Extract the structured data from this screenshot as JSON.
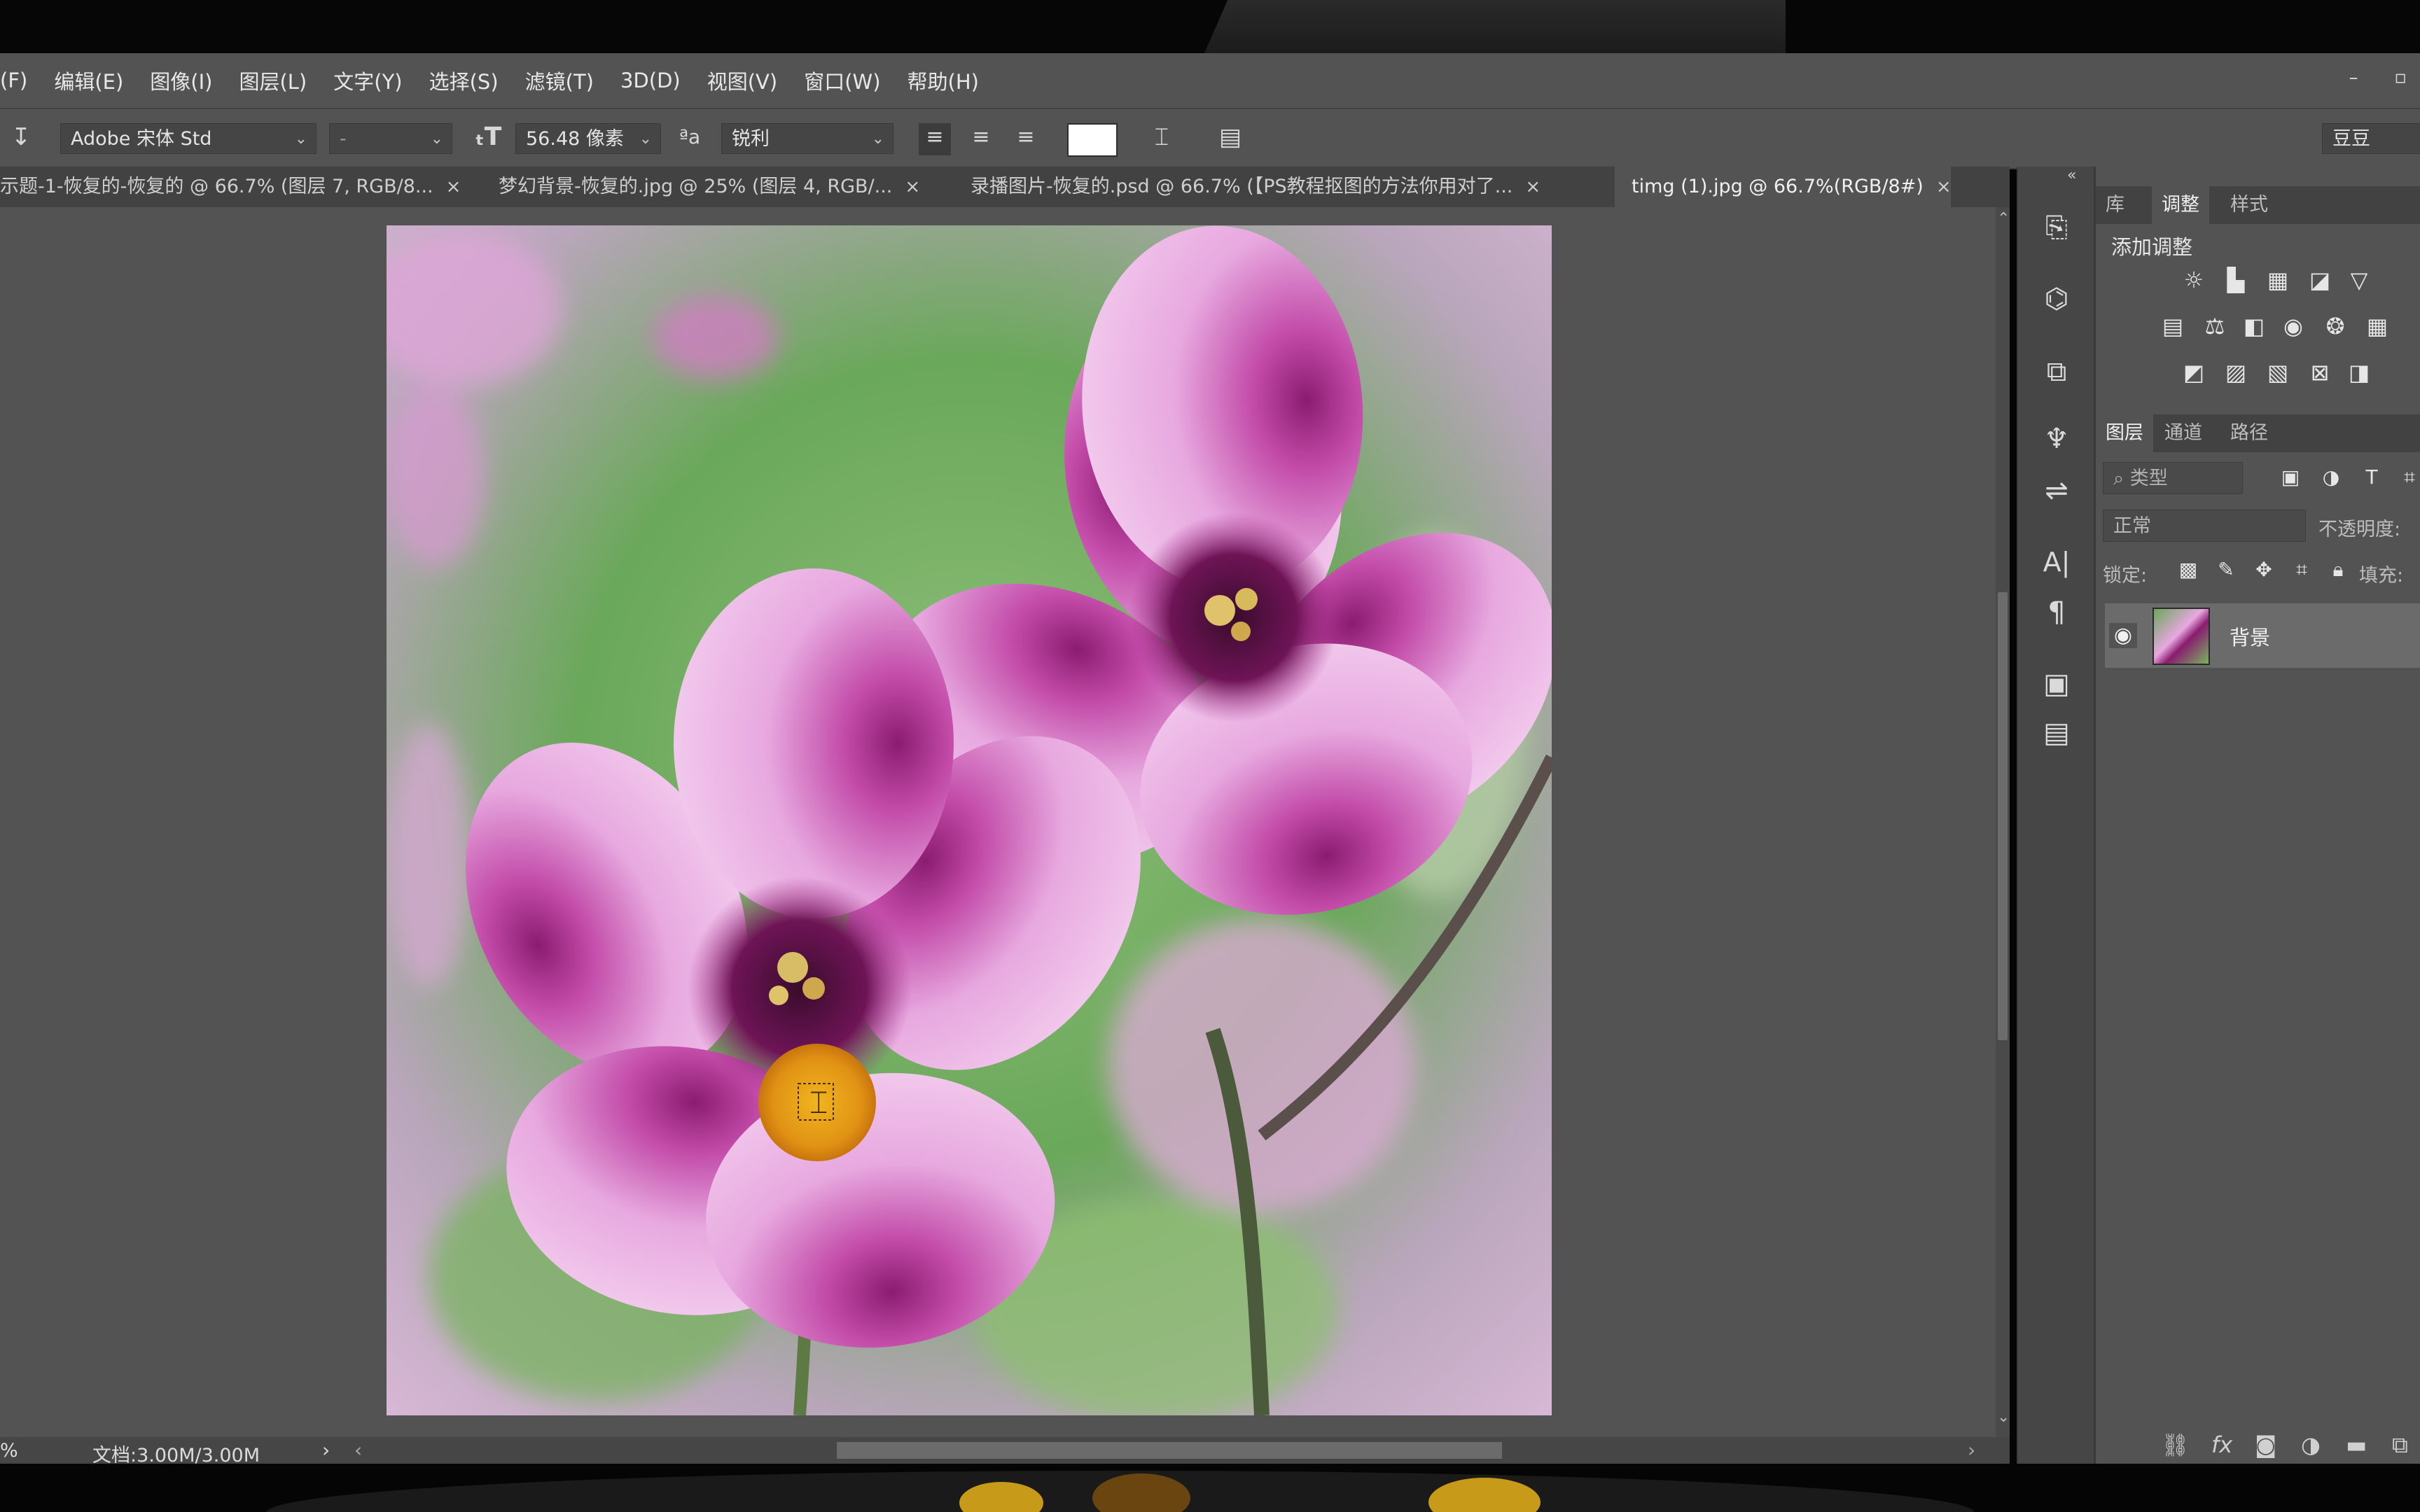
{
  "menu": {
    "items": [
      "(F)",
      "编辑(E)",
      "图像(I)",
      "图层(L)",
      "文字(Y)",
      "选择(S)",
      "滤镜(T)",
      "3D(D)",
      "视图(V)",
      "窗口(W)",
      "帮助(H)"
    ]
  },
  "options": {
    "font_family": "Adobe 宋体 Std",
    "font_style": "-",
    "font_size": "56.48 像素",
    "antialias": "锐利",
    "preset": "豆豆",
    "text_color": "#ffffff"
  },
  "tabs": [
    {
      "label": "示题-1-恢复的-恢复的 @ 66.7% (图层 7, RGB/8...",
      "close": "×"
    },
    {
      "label": "梦幻背景-恢复的.jpg @ 25% (图层 4, RGB/...",
      "close": "×"
    },
    {
      "label": "录播图片-恢复的.psd @ 66.7% (【PS教程抠图的方法你用对了...",
      "close": "×"
    },
    {
      "label": "timg (1).jpg @ 66.7%(RGB/8#)",
      "close": "×"
    }
  ],
  "status": {
    "zoom": "%",
    "doc": "文档:3.00M/3.00M"
  },
  "panels": {
    "top_tabs": [
      "库",
      "调整",
      "样式"
    ],
    "add_adjustment": "添加调整",
    "layer_tabs": [
      "图层",
      "通道",
      "路径"
    ],
    "filter_kind": "类型",
    "blend_mode": "正常",
    "opacity_label": "不透明度:",
    "lock_label": "锁定:",
    "fill_label": "填充:",
    "layer_name": "背景"
  },
  "colors": {
    "accent_orange": "#e2a419",
    "ui_gray": "#535353"
  }
}
